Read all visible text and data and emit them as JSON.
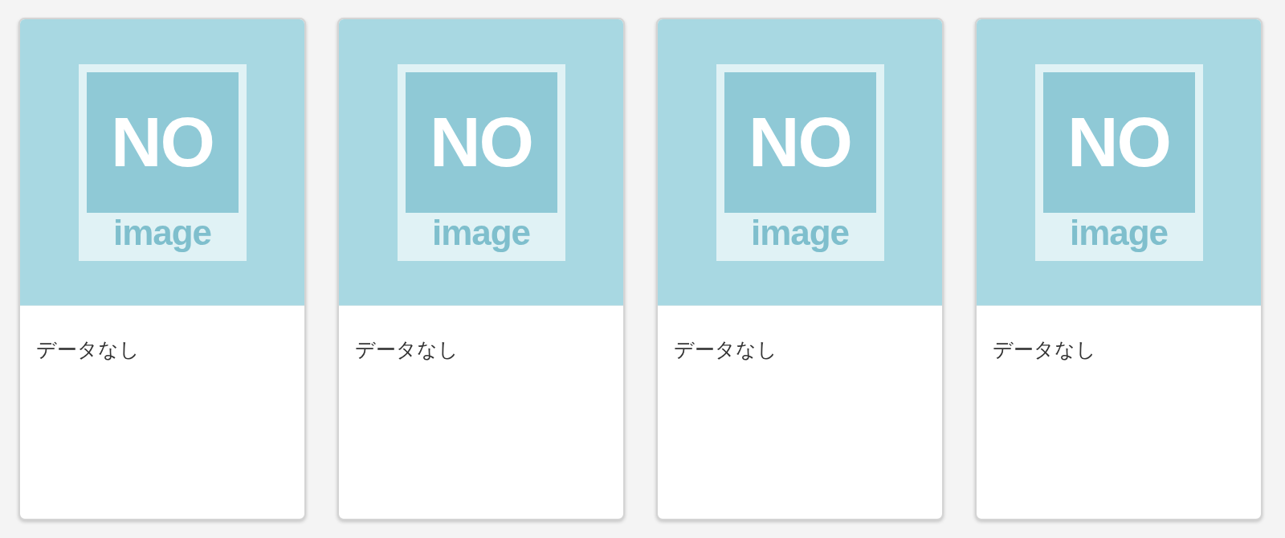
{
  "cards": [
    {
      "placeholder": {
        "top": "NO",
        "bottom": "image"
      },
      "label": "データなし"
    },
    {
      "placeholder": {
        "top": "NO",
        "bottom": "image"
      },
      "label": "データなし"
    },
    {
      "placeholder": {
        "top": "NO",
        "bottom": "image"
      },
      "label": "データなし"
    },
    {
      "placeholder": {
        "top": "NO",
        "bottom": "image"
      },
      "label": "データなし"
    }
  ]
}
